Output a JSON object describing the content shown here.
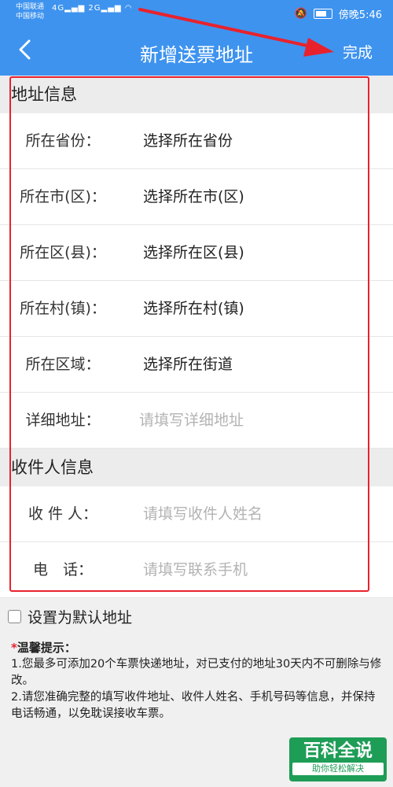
{
  "status_bar": {
    "carrier_1": "中国联通",
    "carrier_2": "中国移动",
    "signal_1": "4G",
    "signal_2": "2G",
    "time": "傍晚5:46"
  },
  "navbar": {
    "title": "新增送票地址",
    "done_label": "完成",
    "back_icon": "chevron-left-icon"
  },
  "address_section": {
    "title": "地址信息",
    "rows": [
      {
        "label": "所在省份：",
        "value": "选择所在省份"
      },
      {
        "label": "所在市(区)：",
        "value": "选择所在市(区)"
      },
      {
        "label": "所在区(县)：",
        "value": "选择所在区(县)"
      },
      {
        "label": "所在村(镇)：",
        "value": "选择所在村(镇)"
      },
      {
        "label": "所在区域：",
        "value": "选择所在街道"
      }
    ],
    "detail": {
      "label": "详细地址：",
      "placeholder": "请填写详细地址"
    }
  },
  "recipient_section": {
    "title": "收件人信息",
    "name": {
      "label": "收 件 人：",
      "placeholder": "请填写收件人姓名"
    },
    "phone": {
      "label": "电　话：",
      "placeholder": "请填写联系手机"
    }
  },
  "default_address": {
    "label": "设置为默认地址"
  },
  "tips": {
    "star": "*",
    "title": "温馨提示：",
    "lines": [
      "1.您最多可添加20个车票快递地址，对已支付的地址30天内不可删除与修改。",
      "2.请您准确完整的填写收件地址、收件人姓名、手机号码等信息，并保持电话畅通，以免耽误接收车票。"
    ]
  },
  "watermark": {
    "main": "百科全说",
    "sub": "助你轻松解决"
  },
  "colors": {
    "primary": "#3e93ef",
    "highlight": "#e8222d",
    "watermark": "#1e9d56"
  }
}
